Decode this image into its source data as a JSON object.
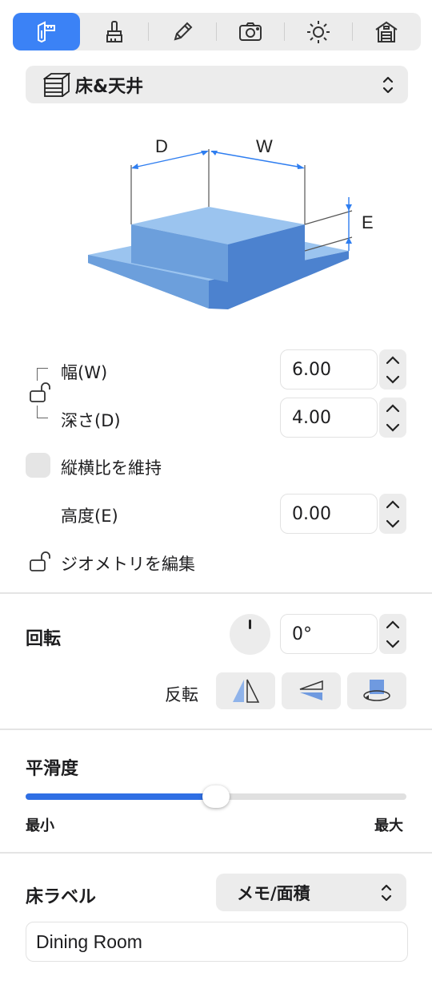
{
  "toolbar": {
    "tabs": [
      {
        "icon": "dimensions-icon",
        "active": true
      },
      {
        "icon": "paint-brush-icon",
        "active": false
      },
      {
        "icon": "pencil-icon",
        "active": false
      },
      {
        "icon": "camera-icon",
        "active": false
      },
      {
        "icon": "sun-icon",
        "active": false
      },
      {
        "icon": "house-icon",
        "active": false
      }
    ],
    "active_color": "#3b82f6"
  },
  "category": {
    "icon": "cube-icon",
    "label": "床&天井"
  },
  "diagram": {
    "labels": {
      "d": "D",
      "w": "W",
      "e": "E"
    }
  },
  "dimensions": {
    "width_label": "幅(W)",
    "width_value": "6.00",
    "depth_label": "深さ(D)",
    "depth_value": "4.00",
    "aspect_label": "縦横比を維持",
    "aspect_checked": false,
    "height_label": "高度(E)",
    "height_value": "0.00",
    "edit_geometry_label": "ジオメトリを編集"
  },
  "rotation": {
    "title": "回転",
    "value": "0°",
    "flip_label": "反転"
  },
  "smoothness": {
    "title": "平滑度",
    "min_label": "最小",
    "max_label": "最大",
    "value": 0.5
  },
  "floor_label": {
    "title": "床ラベル",
    "mode": "メモ/面積",
    "text": "Dining Room"
  }
}
